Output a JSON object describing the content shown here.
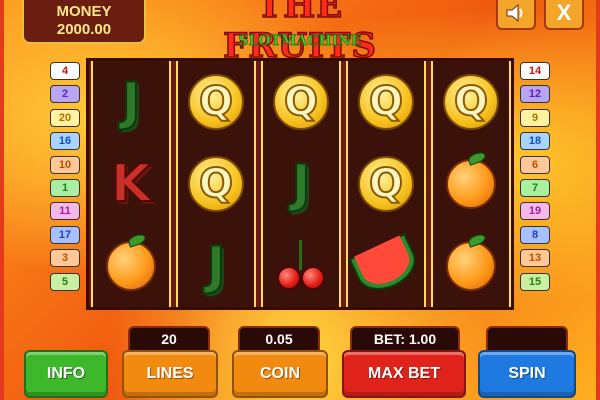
{
  "header": {
    "money_label": "MONEY",
    "money_value": "2000.00",
    "title": "THE FRUITS",
    "subtitle": "SLOTMACHINE",
    "sound_icon": "speaker-icon",
    "close_label": "X"
  },
  "lines_left": [
    "4",
    "2",
    "20",
    "16",
    "10",
    "1",
    "11",
    "17",
    "3",
    "5"
  ],
  "lines_right": [
    "14",
    "12",
    "9",
    "18",
    "6",
    "7",
    "19",
    "8",
    "13",
    "15"
  ],
  "reels": [
    [
      "J",
      "K",
      "orange"
    ],
    [
      "Q",
      "Q",
      "J"
    ],
    [
      "Q",
      "J",
      "cherry"
    ],
    [
      "Q",
      "Q",
      "watermelon"
    ],
    [
      "Q",
      "orange",
      "orange"
    ]
  ],
  "controls": {
    "lines_value": "20",
    "coin_value": "0.05",
    "bet_value": "BET: 1.00",
    "info_label": "INFO",
    "lines_label": "LINES",
    "coin_label": "COIN",
    "maxbet_label": "MAX BET",
    "spin_label": "SPIN"
  },
  "colors": {
    "info": "#3cb82a",
    "lines": "#f28a10",
    "coin": "#f28a10",
    "maxbet": "#e0231a",
    "spin": "#1e7ae0"
  }
}
